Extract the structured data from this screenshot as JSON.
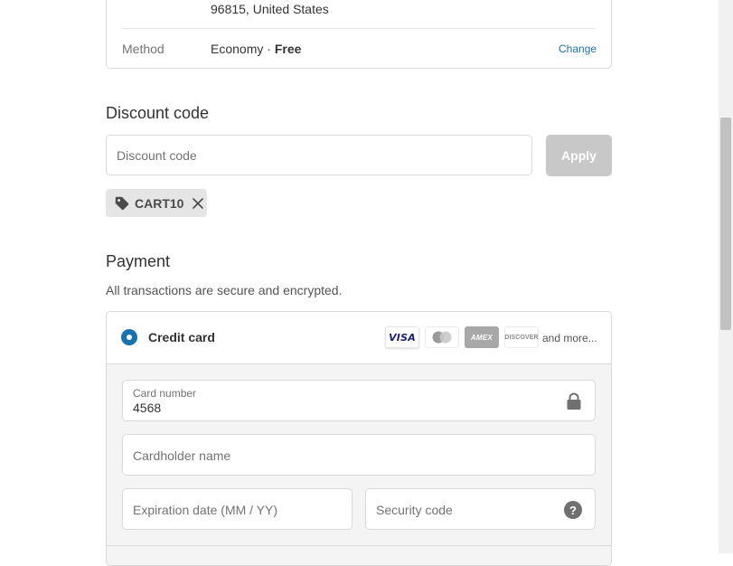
{
  "shipping": {
    "address_line": "96815, United States",
    "method_label": "Method",
    "method_name": "Economy · ",
    "method_price": "Free",
    "change_label": "Change"
  },
  "discount": {
    "title": "Discount code",
    "placeholder": "Discount code",
    "value": "",
    "apply_label": "Apply",
    "applied_code": "CART10"
  },
  "payment": {
    "title": "Payment",
    "subtitle": "All transactions are secure and encrypted.",
    "method_label": "Credit card",
    "logos": {
      "visa": "VISA",
      "amex": "AMEX",
      "discover": "DISCOVER"
    },
    "and_more": "and more...",
    "card_number_label": "Card number",
    "card_number_value": "4568",
    "cardholder_placeholder": "Cardholder name",
    "expiration_placeholder": "Expiration date (MM / YY)",
    "security_placeholder": "Security code",
    "help_glyph": "?"
  },
  "colors": {
    "link": "#1773b0",
    "radio_selected": "#1773b0",
    "apply_disabled": "#c8c8c8"
  },
  "icons": {
    "tag": "tag-icon",
    "remove": "close-icon",
    "lock": "lock-icon",
    "help": "question-circle-icon"
  }
}
